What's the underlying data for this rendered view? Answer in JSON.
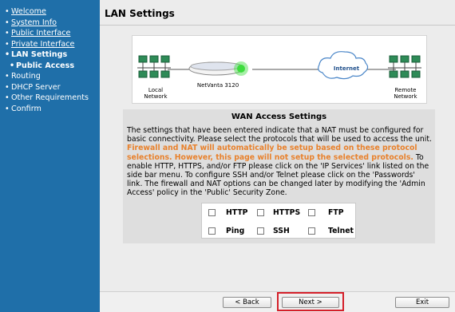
{
  "sidebar": {
    "items": [
      {
        "label": "Welcome"
      },
      {
        "label": "System Info"
      },
      {
        "label": "Public Interface"
      },
      {
        "label": "Private Interface"
      },
      {
        "label": "LAN Settings"
      },
      {
        "label": "Public Access"
      },
      {
        "label": "Routing"
      },
      {
        "label": "DHCP Server"
      },
      {
        "label": "Other Requirements"
      },
      {
        "label": "Confirm"
      }
    ]
  },
  "header": {
    "title": "LAN Settings"
  },
  "diagram": {
    "local_label": "Local\nNetwork",
    "device_label": "NetVanta 3120",
    "internet_label": "Internet",
    "remote_label": "Remote\nNetwork"
  },
  "panel": {
    "title": "WAN Access Settings",
    "text_before": "The settings that have been entered indicate that a NAT must be configured for basic connectivity. Please select the protocols that will be used to access the unit. ",
    "warning": "Firewall and NAT will automatically be setup based on these protocol selections. However, this page will not setup the selected protocols.",
    "text_after": " To enable HTTP, HTTPS, and/or FTP please click on the 'IP Services' link listed on the side bar menu. To configure SSH and/or Telnet please click on the 'Passwords' link. The firewall and NAT options can be changed later by modifying the 'Admin Access' policy in the 'Public' Security Zone."
  },
  "protocols": [
    {
      "label": "HTTP",
      "checked": false
    },
    {
      "label": "HTTPS",
      "checked": false
    },
    {
      "label": "FTP",
      "checked": false
    },
    {
      "label": "Ping",
      "checked": false
    },
    {
      "label": "SSH",
      "checked": false
    },
    {
      "label": "Telnet",
      "checked": false
    }
  ],
  "buttons": {
    "back": "< Back",
    "next": "Next >",
    "exit": "Exit"
  },
  "colors": {
    "sidebar": "#1f6fa9",
    "warning": "#e8812c",
    "highlight": "#d4202a",
    "device_led": "#3ddc3d"
  }
}
